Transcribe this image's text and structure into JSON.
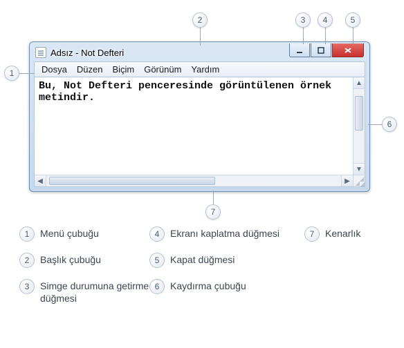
{
  "window": {
    "title": "Adsız - Not Defteri",
    "icon_name": "notepad-icon"
  },
  "menu": {
    "items": [
      "Dosya",
      "Düzen",
      "Biçim",
      "Görünüm",
      "Yardım"
    ]
  },
  "content": {
    "text": "Bu, Not Defteri penceresinde görüntülenen örnek metindir."
  },
  "callouts": {
    "1": "1",
    "2": "2",
    "3": "3",
    "4": "4",
    "5": "5",
    "6": "6",
    "7": "7"
  },
  "legend": {
    "items": [
      {
        "num": "1",
        "label": "Menü çubuğu"
      },
      {
        "num": "2",
        "label": "Başlık çubuğu"
      },
      {
        "num": "3",
        "label": "Simge durumuna getirme düğmesi"
      },
      {
        "num": "4",
        "label": "Ekranı kaplatma düğmesi"
      },
      {
        "num": "5",
        "label": "Kapat düğmesi"
      },
      {
        "num": "6",
        "label": "Kaydırma çubuğu"
      },
      {
        "num": "7",
        "label": "Kenarlık"
      }
    ]
  }
}
